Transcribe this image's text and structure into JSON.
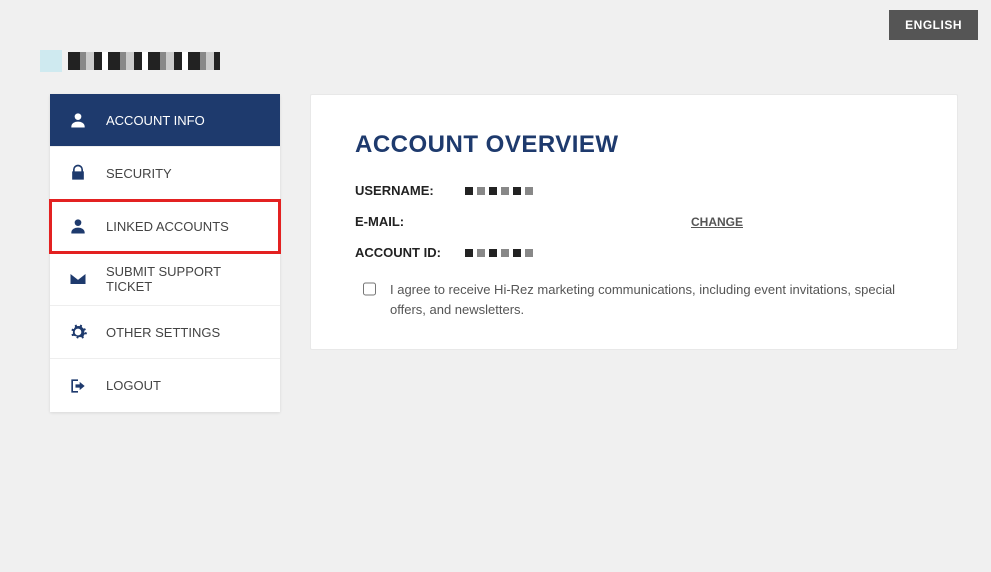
{
  "header": {
    "language_button": "ENGLISH"
  },
  "sidebar": {
    "items": [
      {
        "label": "ACCOUNT INFO"
      },
      {
        "label": "SECURITY"
      },
      {
        "label": "LINKED ACCOUNTS"
      },
      {
        "label": "SUBMIT SUPPORT TICKET"
      },
      {
        "label": "OTHER SETTINGS"
      },
      {
        "label": "LOGOUT"
      }
    ]
  },
  "panel": {
    "title": "ACCOUNT OVERVIEW",
    "username_label": "USERNAME:",
    "email_label": "E-MAIL:",
    "accountid_label": "ACCOUNT ID:",
    "change_link": "CHANGE",
    "consent_text": "I agree to receive Hi-Rez marketing communications, including event invitations, special offers, and newsletters."
  }
}
